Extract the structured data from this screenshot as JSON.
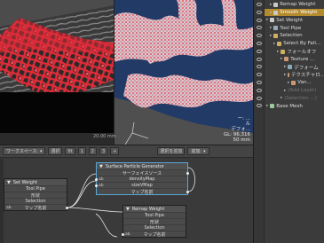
{
  "colors": {
    "accent": "#b58a2d",
    "selected_node_border": "#5aa7d6",
    "map_red": "#e8323f",
    "map_blue": "#223a66"
  },
  "viewport_right": {
    "readout": [
      "ー: ...",
      "ル",
      "デフォ...",
      "GL: 96,316",
      "50 mm"
    ]
  },
  "timeline": {
    "label": "20.00 mm"
  },
  "schematic": {
    "toolbar": {
      "workspace_label": "ワークスペース:",
      "select_label": "選択",
      "toolbar_buttons": [
        "fit",
        "1",
        "2",
        "3",
        "+"
      ],
      "add_selected_label": "選択を追加",
      "add_label": "追加:"
    },
    "nodes": {
      "set_weight": {
        "title": "Set Weight",
        "rows": [
          "Tool Pipe",
          "形状",
          "Selection",
          "マップ名前"
        ],
        "row_port": "ab"
      },
      "surface_generator": {
        "title": "Surface Particle Generator",
        "rows": [
          "サーフェイスソース",
          "densityMap",
          "sizeVMap",
          "マップ名前"
        ],
        "row_ports": [
          "",
          "ab",
          "ab",
          ""
        ]
      },
      "remap_weight": {
        "title": "Remap Weight",
        "rows": [
          "Tool Pipe",
          "形状",
          "Selection",
          "マップ名前"
        ],
        "row_port": "ab"
      }
    }
  },
  "itemlist": {
    "items": [
      {
        "label": "Remap Weight",
        "indent": 1,
        "selected": false,
        "dim": false,
        "icon": "tool-icon"
      },
      {
        "label": "Smooth Weight",
        "indent": 1,
        "selected": true,
        "dim": false,
        "icon": "tool-icon"
      },
      {
        "label": "Set Weight",
        "indent": 0,
        "selected": false,
        "dim": false,
        "icon": "tool-icon"
      },
      {
        "label": "Tool Pipe",
        "indent": 1,
        "selected": false,
        "dim": false,
        "icon": "pipe-icon"
      },
      {
        "label": "Selection",
        "indent": 1,
        "selected": false,
        "dim": false,
        "icon": "selection-icon"
      },
      {
        "label": "Select By Fall...",
        "indent": 2,
        "selected": false,
        "dim": false,
        "icon": "falloff-icon"
      },
      {
        "label": "フォールオフ",
        "indent": 3,
        "selected": false,
        "dim": false,
        "icon": "falloff-icon"
      },
      {
        "label": "Texture ...",
        "indent": 4,
        "selected": false,
        "dim": false,
        "icon": "texture-icon"
      },
      {
        "label": "デフォーム",
        "indent": 5,
        "selected": false,
        "dim": false,
        "icon": "deform-icon"
      },
      {
        "label": "テクスチャロ...",
        "indent": 5,
        "selected": false,
        "dim": false,
        "icon": "texture-icon"
      },
      {
        "label": "Van...",
        "indent": 6,
        "selected": false,
        "dim": false,
        "icon": "texture-icon"
      },
      {
        "label": "(Add Layer)",
        "indent": 5,
        "selected": false,
        "dim": true,
        "icon": ""
      },
      {
        "label": "(Selection ...)",
        "indent": 4,
        "selected": false,
        "dim": true,
        "icon": ""
      },
      {
        "label": "Base Mesh",
        "indent": 0,
        "selected": false,
        "dim": false,
        "icon": "mesh-icon"
      }
    ]
  }
}
